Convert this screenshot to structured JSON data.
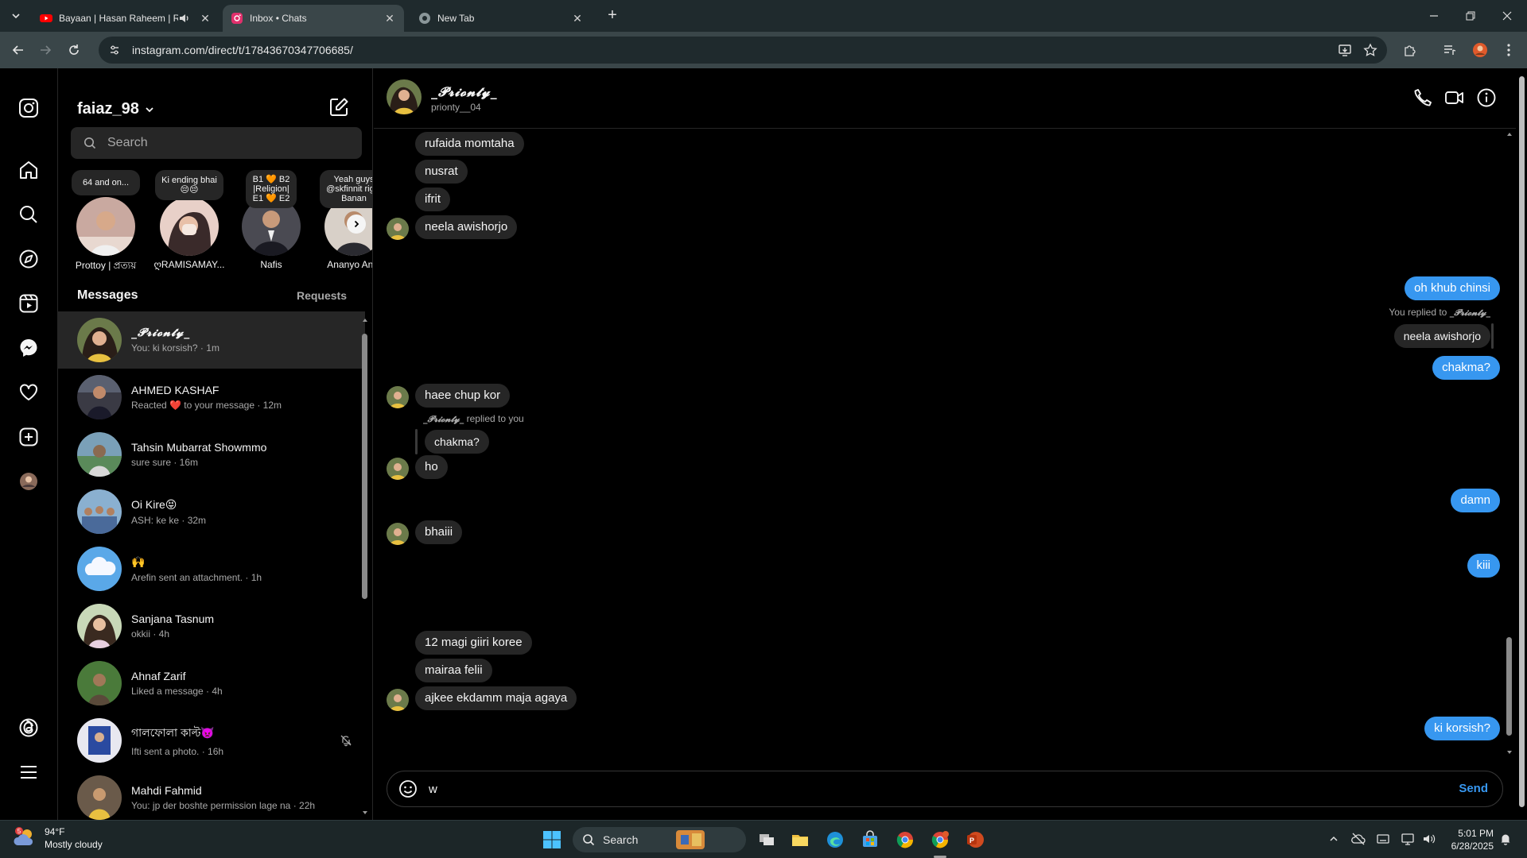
{
  "browser": {
    "tabs": [
      {
        "title": "Bayaan | Hasan Raheem | Ro",
        "favicon": "youtube-icon",
        "audio": true
      },
      {
        "title": "Inbox • Chats",
        "favicon": "instagram-icon",
        "active": true
      },
      {
        "title": "New Tab",
        "favicon": "chrome-icon"
      }
    ],
    "url": "instagram.com/direct/t/17843670347706685/"
  },
  "inbox": {
    "username": "faiaz_98",
    "search_placeholder": "Search",
    "notes": [
      {
        "text": "64 and on...",
        "name": "Prottoy | প্রত্যয়"
      },
      {
        "text": "Ki ending bhai 😔😔",
        "name": "ღRAMISAMAY..."
      },
      {
        "text": "B1 🧡 B2 |Religion| E1 🧡 E2",
        "name": "Nafis"
      },
      {
        "text": "Yeah guys @skfinnit right Banan",
        "name": "Ananyo Anul"
      }
    ],
    "messages_label": "Messages",
    "requests_label": "Requests",
    "threads": [
      {
        "name": "_𝓟𝓻𝓲𝓸𝓷𝓽𝔂_",
        "sub": "You: ki korsish? · 1m",
        "active": true
      },
      {
        "name": "AHMED KASHAF",
        "sub": "Reacted ❤️ to your message · 12m"
      },
      {
        "name": "Tahsin Mubarrat Showmmo",
        "sub": "sure sure · 16m"
      },
      {
        "name": "Oi Kire😝",
        "sub": "ASH: ke ke · 32m"
      },
      {
        "name": "🙌",
        "sub": "Arefin sent an attachment. · 1h"
      },
      {
        "name": "Sanjana Tasnum",
        "sub": "okkii · 4h"
      },
      {
        "name": "Ahnaf Zarif",
        "sub": "Liked a message · 4h"
      },
      {
        "name": "গালফোলা কাল্ট👿",
        "sub": "Ifti sent a photo. · 16h",
        "muted": true
      },
      {
        "name": "Mahdi Fahmid",
        "sub": "You: jp der boshte permission lage na · 22h"
      }
    ]
  },
  "chat": {
    "name": "_𝓟𝓻𝓲𝓸𝓷𝓽𝔂_",
    "handle": "prionty__04",
    "messages": [
      {
        "text": "rufaida momtaha",
        "dir": "in"
      },
      {
        "text": "nusrat",
        "dir": "in"
      },
      {
        "text": "ifrit",
        "dir": "in"
      },
      {
        "text": "neela awishorjo",
        "dir": "in"
      },
      {
        "text": "oh khub chinsi",
        "dir": "out"
      },
      {
        "text": "neela awishorjo",
        "dir": "quoted"
      },
      {
        "text": "chakma?",
        "dir": "out"
      },
      {
        "text": "haee chup kor",
        "dir": "in"
      },
      {
        "text": "chakma?",
        "dir": "quoted"
      },
      {
        "text": "ho",
        "dir": "in"
      },
      {
        "text": "damn",
        "dir": "out"
      },
      {
        "text": "bhaiii",
        "dir": "in"
      },
      {
        "text": "kiii",
        "dir": "out"
      },
      {
        "text": "12 magi  giiri koree",
        "dir": "in"
      },
      {
        "text": "mairaa felii",
        "dir": "in"
      },
      {
        "text": "ajkee ekdamm maja agaya",
        "dir": "in"
      },
      {
        "text": "ki korsish?",
        "dir": "out"
      }
    ],
    "reply_you_prefix": "You replied to",
    "reply_them_suffix": "replied to you",
    "composer_value": "w",
    "send_label": "Send"
  },
  "taskbar": {
    "weather_temp": "94°F",
    "weather_desc": "Mostly cloudy",
    "weather_badge": "5",
    "search_label": "Search",
    "time": "5:01 PM",
    "date": "6/28/2025"
  },
  "colors": {
    "accent": "#3797f0",
    "incoming_bubble": "#262626",
    "background": "#000000"
  }
}
